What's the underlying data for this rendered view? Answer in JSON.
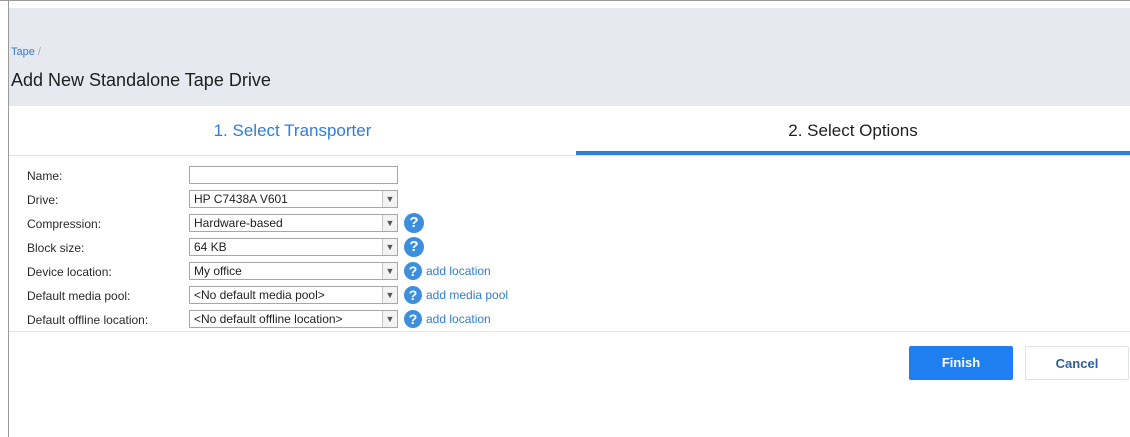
{
  "breadcrumb": {
    "parent": "Tape",
    "separator": "/"
  },
  "page_title": "Add New Standalone Tape Drive",
  "tabs": [
    {
      "label": "1. Select Transporter",
      "active": false
    },
    {
      "label": "2. Select Options",
      "active": true
    }
  ],
  "form": {
    "name": {
      "label": "Name:",
      "value": ""
    },
    "drive": {
      "label": "Drive:",
      "value": "HP C7438A V601"
    },
    "compression": {
      "label": "Compression:",
      "value": "Hardware-based"
    },
    "block_size": {
      "label": "Block size:",
      "value": "64 KB"
    },
    "device_location": {
      "label": "Device location:",
      "value": "My office",
      "link": "add location"
    },
    "default_media_pool": {
      "label": "Default media pool:",
      "value": "<No default media pool>",
      "link": "add media pool"
    },
    "default_offline_location": {
      "label": "Default offline location:",
      "value": "<No default offline location>",
      "link": "add location"
    }
  },
  "icons": {
    "dropdown": "chevron-down-icon",
    "help": "question-circle-icon"
  },
  "colors": {
    "accent": "#2f7ed8",
    "primary_button": "#1f7ff0",
    "header_bg": "#e6e9f0"
  },
  "buttons": {
    "finish": "Finish",
    "cancel": "Cancel"
  }
}
